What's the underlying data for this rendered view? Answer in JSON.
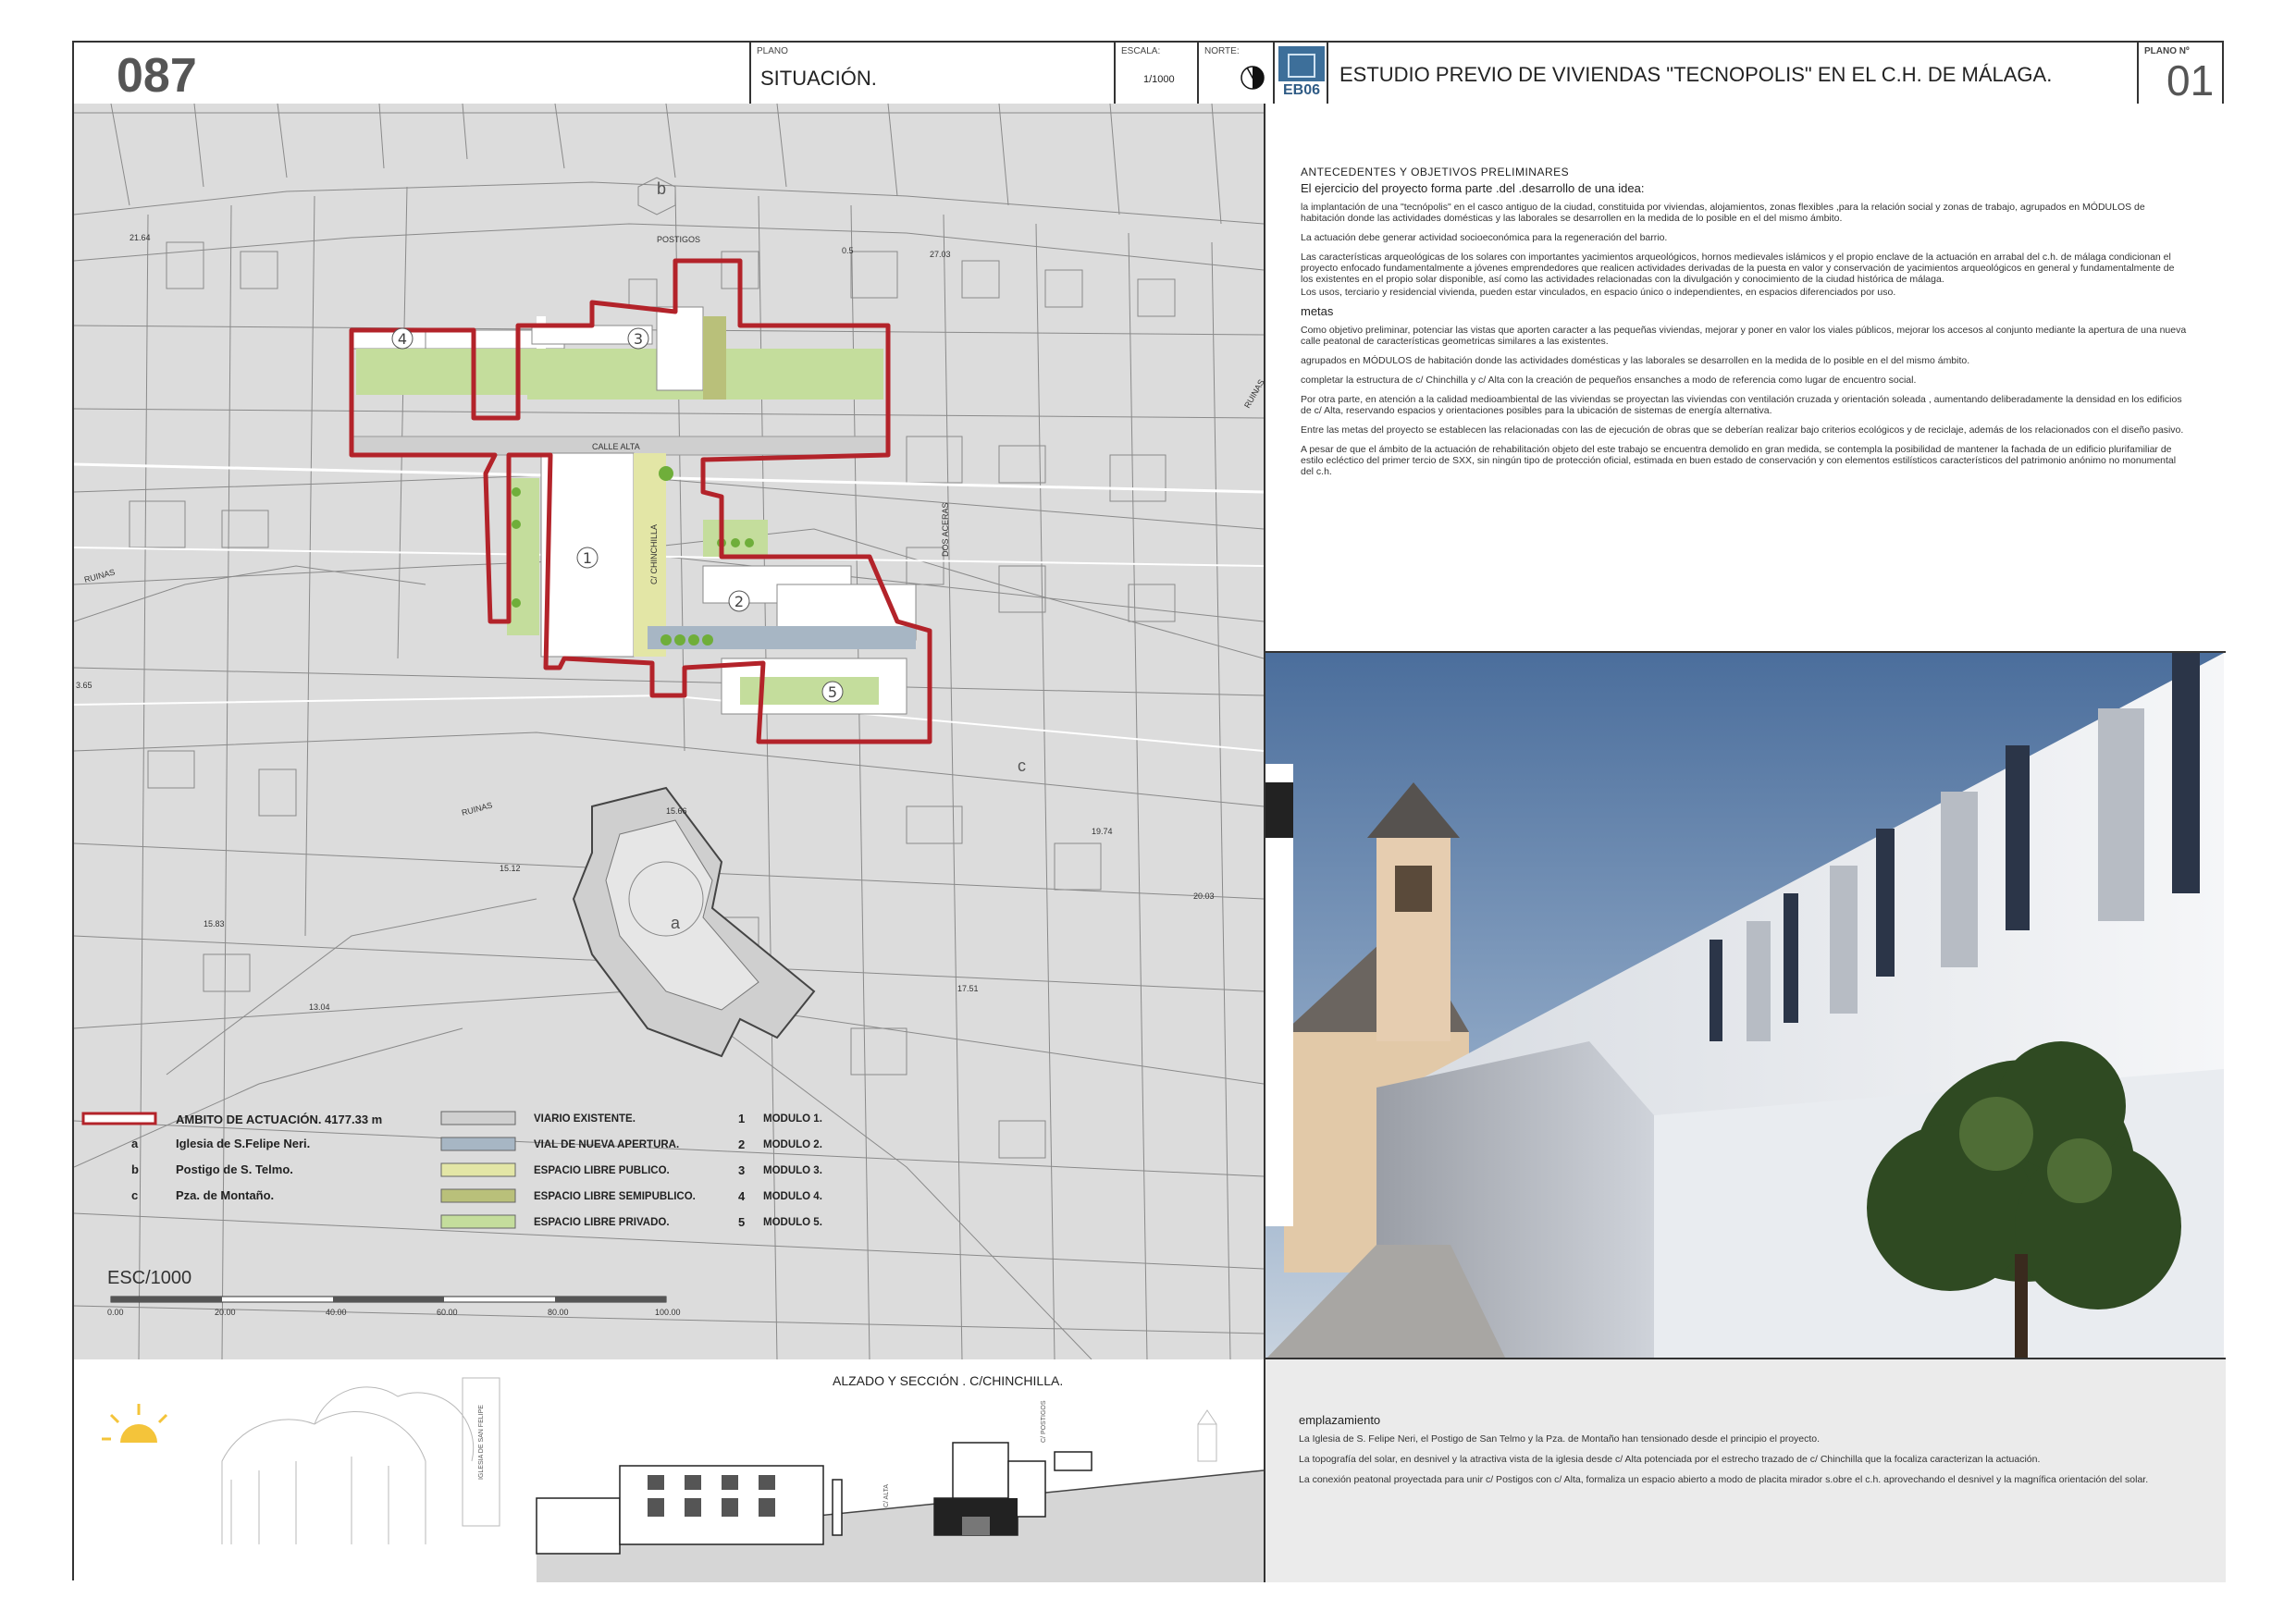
{
  "header": {
    "sheet_code": "087",
    "plano_caption": "PLANO",
    "plano_value": "SITUACIÓN.",
    "escala_caption": "ESCALA:",
    "escala_value": "1/1000",
    "norte_caption": "NORTE:",
    "logo_text": "EB06",
    "project_title": "ESTUDIO PREVIO DE VIVIENDAS \"TECNOPOLIS\" EN EL  C.H. DE MÁLAGA.",
    "plano_n_caption": "PLANO Nº",
    "plano_n_value": "01"
  },
  "map": {
    "street_labels": {
      "postigos": "POSTIGOS",
      "calle_alta": "CALLE ALTA",
      "chinchilla": "C/ CHINCHILLA",
      "dos_aceras": "DOS ACERAS",
      "ruinas_1": "RUINAS",
      "ruinas_2": "RUINAS",
      "ruinas_3": "RUINAS"
    },
    "letters": {
      "a": "a",
      "b": "b",
      "c": "c"
    },
    "modules": [
      "1",
      "2",
      "3",
      "4",
      "5"
    ],
    "elevations": [
      "21.64",
      "0.5",
      "27.03",
      "3.65",
      "15.66",
      "19.74",
      "15.12",
      "20.03",
      "15.83",
      "17.51",
      "13.04"
    ],
    "legend_left": [
      {
        "key": "",
        "label": "AMBITO DE ACTUACIÓN. 4177.33 m"
      },
      {
        "key": "a",
        "label": "Iglesia de S.Felipe Neri."
      },
      {
        "key": "b",
        "label": "Postigo de S. Telmo."
      },
      {
        "key": "c",
        "label": "Pza. de Montaño."
      }
    ],
    "legend_mid": [
      {
        "label": "VIARIO EXISTENTE.",
        "color": "#cfcfcf"
      },
      {
        "label": "VIAL DE NUEVA APERTURA.",
        "color": "#a7b6c4"
      },
      {
        "label": "ESPACIO LIBRE PUBLICO.",
        "color": "#e3e6a6"
      },
      {
        "label": "ESPACIO LIBRE SEMIPUBLICO.",
        "color": "#b9c07a"
      },
      {
        "label": "ESPACIO LIBRE PRIVADO.",
        "color": "#c4dd9c"
      }
    ],
    "legend_right": [
      {
        "num": "1",
        "label": "MODULO 1."
      },
      {
        "num": "2",
        "label": "MODULO 2."
      },
      {
        "num": "3",
        "label": "MODULO 3."
      },
      {
        "num": "4",
        "label": "MODULO 4."
      },
      {
        "num": "5",
        "label": "MODULO 5."
      }
    ],
    "scale_label": "ESC/1000",
    "scale_ticks": [
      "0.00",
      "20.00",
      "40.00",
      "60.00",
      "80.00",
      "100.00"
    ]
  },
  "text_panel": {
    "heading": "ANTECEDENTES  Y  OBJETIVOS PRELIMINARES",
    "subheading": "El  ejercicio  del  proyecto  forma  parte .del .desarrollo  de  una  idea:",
    "paragraphs": [
      "la implantación  de  una \"tecnópolis\" en el casco antiguo de la ciudad,  constituida  por viviendas, alojamientos, zonas flexibles ,para  la  relación social  y  zonas  de trabajo, agrupados en MÓDULOS de habitación  donde las actividades domésticas  y las laborales  se desarrollen en la medida de lo posible en el del mismo ámbito.",
      "La  actuación  debe  generar  actividad  socioeconómica  para  la  regeneración del barrio.",
      "Las características arqueológicas de los  solares con importantes yacimientos arqueológicos, hornos medievales islámicos y el propio enclave  de la actuación  en  arrabal del c.h. de málaga  condicionan el proyecto enfocado fundamentalmente a jóvenes emprendedores que realicen  actividades  derivadas  de  la  puesta  en valor y conservación  de  yacimientos arqueológicos en general y fundamentalmente  de  los  existentes  en  el  propio  solar  disponible, así como las actividades relacionadas  con  la  divulgación y conocimiento de la ciudad histórica  de  málaga.",
      "Los usos, terciario y residencial vivienda, pueden estar  vinculados,  en espacio único o  independientes,  en espacios diferenciados por  uso."
    ],
    "metas_heading": "metas",
    "metas_paragraphs": [
      "Como  objetivo preliminar,  potenciar las  vistas  que  aporten  caracter  a  las  pequeñas viviendas, mejorar y poner en valor los viales públicos, mejorar los accesos al conjunto mediante  la  apertura de  una   nueva  calle   peatonal  de  características  geometricas similares a las existentes.",
      "agrupados  en  MÓDULOS de habitación  donde las actividades domésticas  y las laborales  se desarrollen  en la medida  de lo posible en el del  mismo  ámbito.",
      "completar  la estructura de c/ Chinchilla y c/ Alta  con  la  creación  de  pequeños ensanches a modo de referencia  como lugar de encuentro social.",
      "Por  otra  parte,  en  atención  a  la  calidad medioambiental de las viviendas  se  proyectan  las  viviendas  con ventilación  cruzada y orientación  soleada  , aumentando deliberadamente la densidad en los edificios de c/ Alta, reservando espacios y orientaciones posibles para la ubicación de sistemas de energía alternativa.",
      "Entre  las metas del proyecto  se establecen  las relacionadas con las de ejecución de obras  que  se  deberían realizar bajo criterios ecológicos y de reciclaje, además de  los relacionados con el  diseño  pasivo.",
      "A  pesar  de  que el ámbito de la actuación de rehabilitación  objeto del este  trabajo se encuentra demolido en gran medida,  se contempla  la posibilidad de mantener  la fachada  de  un  edificio plurifamiliar de estilo ecléctico del primer tercio de SXX, sin ningún tipo de protección oficial, estimada en buen estado de conservación y con elementos estilísticos  característicos del patrimonio  anónimo  no monumental del c.h."
    ]
  },
  "section": {
    "title": "ALZADO Y SECCIÓN . C/CHINCHILLA.",
    "label_iglesia": "IGLESIA DE SAN FELIPE",
    "label_alta": "C/ ALTA",
    "label_postigos": "C/ POSTIGOS"
  },
  "emplazamiento": {
    "heading": "emplazamiento",
    "paragraphs": [
      "La Iglesia  de   S. Felipe Neri, el Postigo de San Telmo  y  la  Pza. de Montaño  han  tensionado  desde  el  principio  el  proyecto.",
      "La topografía  del solar, en  desnivel  y  la  atractiva vista  de  la iglesia desde c/ Alta  potenciada  por el estrecho trazado de  c/ Chinchilla que la focaliza caracterizan la actuación.",
      "La conexión  peatonal  proyectada para unir c/ Postigos  con  c/  Alta,   formaliza  un  espacio abierto a modo de placita  mirador s.obre el c.h. aprovechando  el desnivel y la magnífica orientación del solar."
    ]
  },
  "colors": {
    "boundary": "#b3232a",
    "map_bg": "#dcdcdc",
    "lot_line": "#8a8a8a",
    "private_green": "#c4dd9c",
    "new_street": "#a7b6c4",
    "public_space": "#e3e6a6"
  },
  "icons": [
    "north-arrow-icon",
    "eb06-logo-icon",
    "sun-icon"
  ]
}
